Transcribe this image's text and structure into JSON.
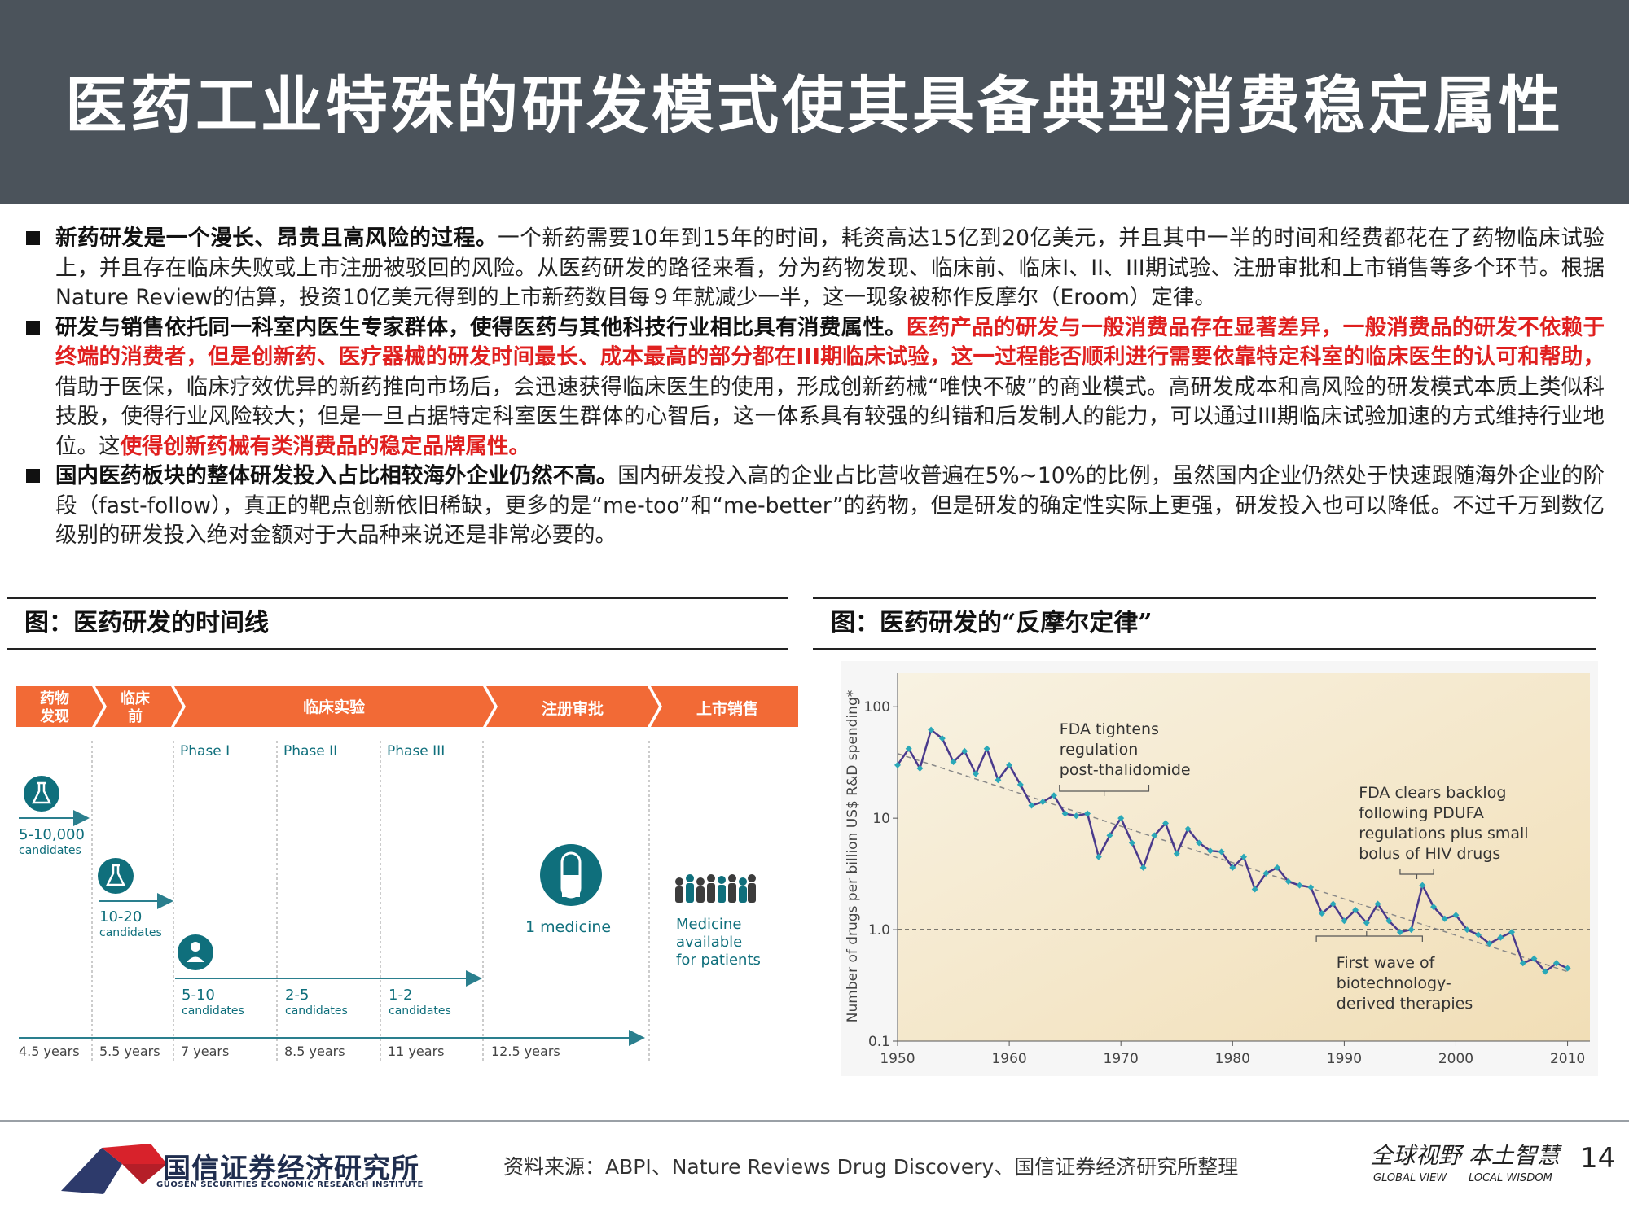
{
  "title": "医药工业特殊的研发模式使其具备典型消费稳定属性",
  "bullets": [
    {
      "bold": "新药研发是一个漫长、昂贵且高风险的过程。",
      "text": "一个新药需要10年到15年的时间，耗资高达15亿到20亿美元，并且其中一半的时间和经费都花在了药物临床试验上，并且存在临床失败或上市注册被驳回的风险。从医药研发的路径来看，分为药物发现、临床前、临床I、II、III期试验、注册审批和上市销售等多个环节。根据Nature Review的估算，投资10亿美元得到的上市新药数目每９年就减少一半，这一现象被称作反摩尔（Eroom）定律。"
    },
    {
      "bold": "研发与销售依托同一科室内医生专家群体，使得医药与其他科技行业相比具有消费属性。",
      "red1": "医药产品的研发与一般消费品存在显著差异，一般消费品的研发不依赖于终端的消费者，但是创新药、医疗器械的研发时间最长、成本最高的部分都在III期临床试验，这一过程能否顺利进行需要依靠特定科室的临床医生的认可和帮助，",
      "text": "借助于医保，临床疗效优异的新药推向市场后，会迅速获得临床医生的使用，形成创新药械“唯快不破”的商业模式。高研发成本和高风险的研发模式本质上类似科技股，使得行业风险较大；但是一旦占据特定科室医生群体的心智后，这一体系具有较强的纠错和后发制人的能力，可以通过III期临床试验加速的方式维持行业地位。这",
      "red2": "使得创新药械有类消费品的稳定品牌属性。"
    },
    {
      "bold": "国内医药板块的整体研发投入占比相较海外企业仍然不高。",
      "text": "国内研发投入高的企业占比营收普遍在5%~10%的比例，虽然国内企业仍然处于快速跟随海外企业的阶段（fast-follow），真正的靶点创新依旧稀缺，更多的是“me-too”和“me-better”的药物，但是研发的确定性实际上更强，研发投入也可以降低。不过千万到数亿级别的研发投入绝对金额对于大品种来说还是非常必要的。"
    }
  ],
  "fig_left": {
    "caption": "图：医药研发的时间线",
    "stages": [
      "药物\n发现",
      "临床\n前",
      "临床实验",
      "注册审批",
      "上市销售"
    ],
    "phases": [
      "Phase I",
      "Phase II",
      "Phase III"
    ],
    "counts": [
      {
        "num": "5-10,000",
        "unit": "candidates"
      },
      {
        "num": "10-20",
        "unit": "candidates"
      },
      {
        "num": "5-10",
        "unit": "candidates"
      },
      {
        "num": "2-5",
        "unit": "candidates"
      },
      {
        "num": "1-2",
        "unit": "candidates"
      }
    ],
    "medicine": "1 medicine",
    "patients": [
      "Medicine",
      "available",
      "for patients"
    ],
    "years": [
      "4.5 years",
      "5.5 years",
      "7 years",
      "8.5 years",
      "11 years",
      "12.5 years"
    ],
    "colors": {
      "orange": "#f26a36",
      "teal": "#0f6f7c",
      "line": "#2a7f8e"
    }
  },
  "fig_right": {
    "caption": "图：医药研发的“反摩尔定律”"
  },
  "chart_data": {
    "type": "line",
    "ylabel": "Number of drugs per billion US$ R&D spending*",
    "xlabel": "",
    "y_scale": "log",
    "ylim": [
      0.1,
      200
    ],
    "xlim": [
      1950,
      2012
    ],
    "xticks": [
      1950,
      1960,
      1970,
      1980,
      1990,
      2000,
      2010
    ],
    "yticks": [
      0.1,
      1.0,
      10,
      100
    ],
    "ytick_labels": [
      "0.1",
      "1.0",
      "10",
      "100"
    ],
    "grid": false,
    "reference_line": 1.0,
    "series": [
      {
        "color": "#4a3a8c",
        "x": [
          1950,
          1951,
          1952,
          1953,
          1954,
          1955,
          1956,
          1957,
          1958,
          1959,
          1960,
          1961,
          1962,
          1963,
          1964,
          1965,
          1966,
          1967,
          1968,
          1969,
          1970,
          1971,
          1972,
          1973,
          1974,
          1975,
          1976,
          1977,
          1978,
          1979,
          1980,
          1981,
          1982,
          1983,
          1984,
          1985,
          1986,
          1987,
          1988,
          1989,
          1990,
          1991,
          1992,
          1993,
          1994,
          1995,
          1996,
          1997,
          1998,
          1999,
          2000,
          2001,
          2002,
          2003,
          2004,
          2005,
          2006,
          2007,
          2008,
          2009,
          2010
        ],
        "y": [
          30,
          42,
          28,
          62,
          52,
          32,
          40,
          25,
          42,
          22,
          30,
          20,
          13,
          14,
          16,
          11,
          10.5,
          11,
          4.5,
          7,
          10,
          6,
          3.6,
          7,
          9,
          4.8,
          8,
          6,
          5.1,
          5,
          3.6,
          4.5,
          2.3,
          3.2,
          3.6,
          2.7,
          2.5,
          2.4,
          1.4,
          1.7,
          1.2,
          1.5,
          1.15,
          1.7,
          1.2,
          0.95,
          1.0,
          2.5,
          1.6,
          1.25,
          1.35,
          1.0,
          0.9,
          0.75,
          0.85,
          0.95,
          0.5,
          0.55,
          0.42,
          0.5,
          0.45
        ]
      },
      {
        "name": "trend",
        "color": "#888888",
        "x": [
          1950,
          2010
        ],
        "y": [
          38,
          0.42
        ]
      }
    ],
    "annotations": [
      {
        "text": "FDA tightens regulation post-thalidomide",
        "lines": [
          "FDA tightens",
          "regulation",
          "post-thalidomide"
        ]
      },
      {
        "text": "FDA clears backlog following PDUFA regulations plus small bolus of HIV drugs",
        "lines": [
          "FDA clears backlog",
          "following PDUFA",
          "regulations plus small",
          "bolus of HIV drugs"
        ]
      },
      {
        "text": "First wave of biotechnology-derived therapies",
        "lines": [
          "First wave of",
          "biotechnology-",
          "derived therapies"
        ]
      }
    ]
  },
  "footer": {
    "source": "资料来源：ABPI、Nature Reviews Drug Discovery、国信证券经济研究所整理",
    "org_cn": "国信证券经济研究所",
    "org_en": "GUOSEN SECURITIES ECONOMIC RESEARCH INSTITUTE",
    "slogan_cn": "全球视野 本土智慧",
    "slogan_en1": "GLOBAL VIEW",
    "slogan_en2": "LOCAL WISDOM",
    "page": "14"
  }
}
